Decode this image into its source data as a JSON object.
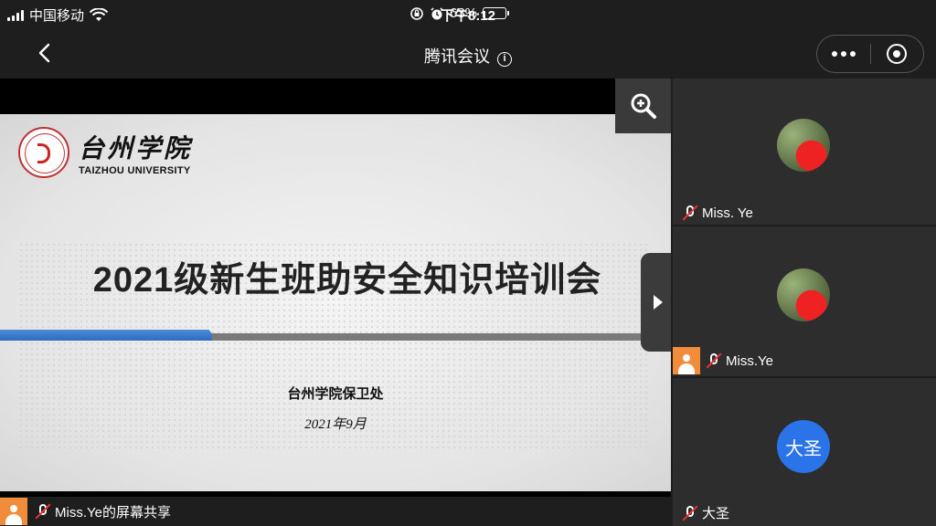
{
  "status_bar": {
    "carrier": "中国移动",
    "time": "下午8:12",
    "battery": "63%"
  },
  "nav": {
    "title": "腾讯会议"
  },
  "slide": {
    "logo_cn": "台州学院",
    "logo_en": "TAIZHOU UNIVERSITY",
    "title": "2021级新生班助安全知识培训会",
    "organizer": "台州学院保卫处",
    "date": "2021年9月"
  },
  "share_label": "Miss.Ye的屏幕共享",
  "participants": [
    {
      "name": "Miss. Ye"
    },
    {
      "name": "Miss.Ye"
    },
    {
      "name": "大圣",
      "avatar_text": "大圣"
    }
  ],
  "colors": {
    "background": "#1e1e1e",
    "tile": "#2d2d2d",
    "accent_blue": "#2a73e8",
    "avatar_orange": "#f08c3a",
    "muted_red": "#e33333"
  },
  "icons": [
    "signal-icon",
    "wifi-icon",
    "lock-rotation-icon",
    "alarm-icon",
    "battery-icon",
    "back-icon",
    "info-icon",
    "more-icon",
    "close-miniprogram-icon",
    "zoom-in-icon",
    "expand-arrow-icon",
    "mic-muted-icon",
    "person-icon"
  ]
}
